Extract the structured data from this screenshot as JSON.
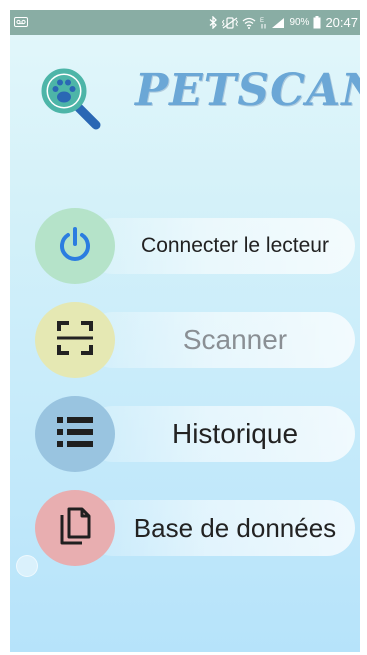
{
  "status_bar": {
    "battery_percent": "90%",
    "time": "20:47",
    "icons": [
      "voicemail-icon",
      "bluetooth-icon",
      "vibrate-icon",
      "wifi-icon",
      "data-icon",
      "signal-icon",
      "battery-icon"
    ]
  },
  "header": {
    "app_title": "PETSCAN",
    "logo_icon": "paw-magnifier-icon"
  },
  "menu": [
    {
      "label": "Connecter le lecteur",
      "icon": "power-icon",
      "circle_color": "#b5e3c9",
      "icon_color": "#2b7de0",
      "label_color": "#222222"
    },
    {
      "label": "Scanner",
      "icon": "scan-frame-icon",
      "circle_color": "#e5e8b3",
      "icon_color": "#222222",
      "label_color": "#8a8f94"
    },
    {
      "label": "Historique",
      "icon": "list-icon",
      "circle_color": "#99c4e0",
      "icon_color": "#1f1f1f",
      "label_color": "#222222"
    },
    {
      "label": "Base de données",
      "icon": "copy-icon",
      "circle_color": "#e8aeb0",
      "icon_color": "#1f1f1f",
      "label_color": "#222222"
    }
  ],
  "colors": {
    "status_bar_bg": "#89ada4",
    "title_color": "#6ba7d6",
    "logo_teal": "#4db5a8",
    "logo_blue": "#2a67b4"
  }
}
